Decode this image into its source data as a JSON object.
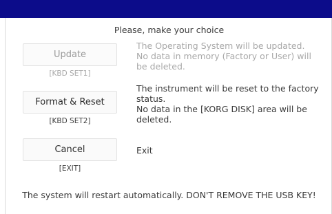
{
  "heading": "Please, make your choice",
  "options": [
    {
      "button_label": "Update",
      "shortcut": "[KBD SET1]",
      "description_lines": [
        "The Operating System will be updated.",
        "No data in memory (Factory or User) will",
        "be deleted."
      ]
    },
    {
      "button_label": "Format & Reset",
      "shortcut": "[KBD SET2]",
      "description_lines": [
        "The instrument will be reset to the factory",
        "status.",
        "No data in the [KORG DISK] area will be",
        "deleted."
      ]
    },
    {
      "button_label": "Cancel",
      "shortcut": "[EXIT]",
      "description_lines": [
        "Exit"
      ]
    }
  ],
  "footer": "The system will restart automatically. DON'T REMOVE THE USB KEY!",
  "colors": {
    "titlebar": "#0c0c8a",
    "disabled_text": "#a8a8a8"
  }
}
